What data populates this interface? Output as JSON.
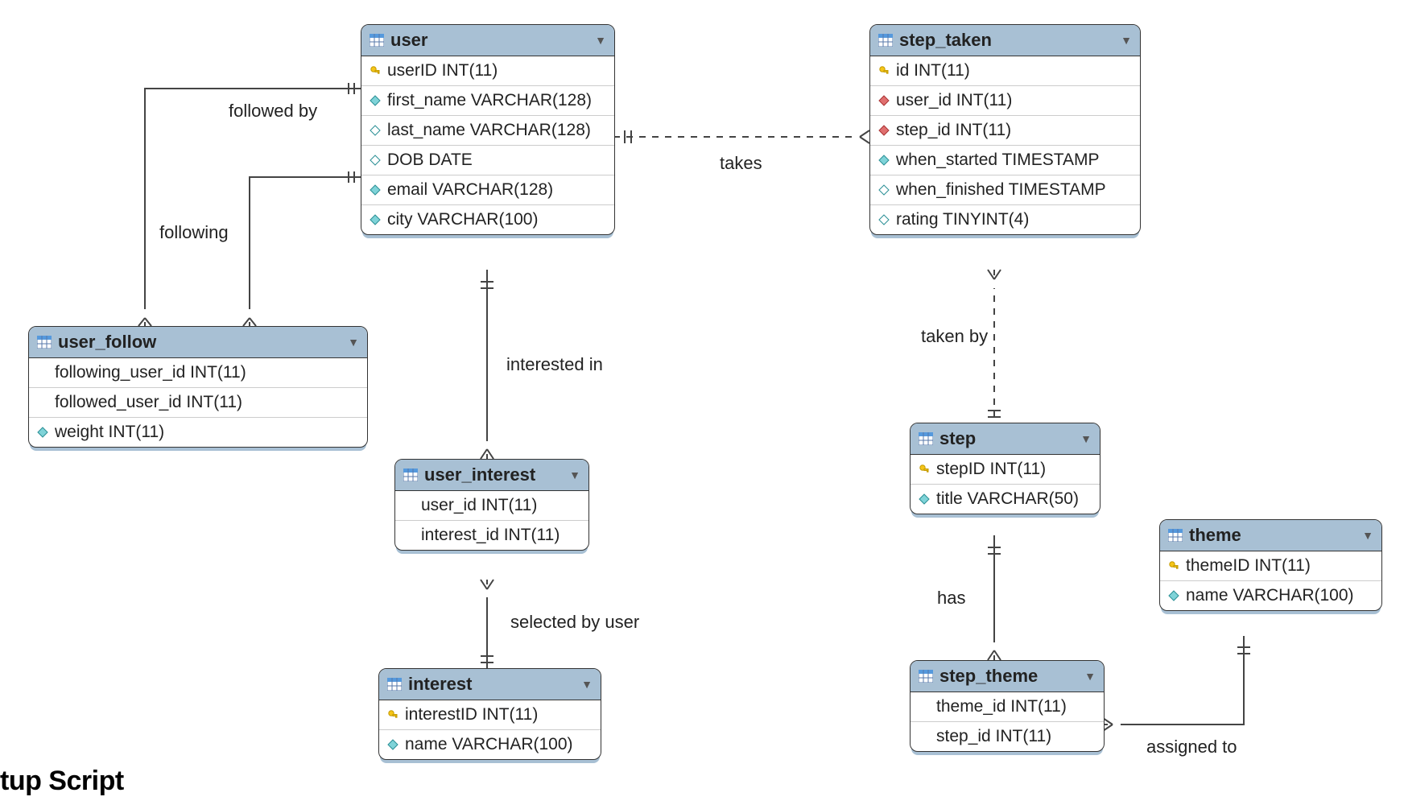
{
  "entities": {
    "user": {
      "title": "user",
      "cols": [
        {
          "icon": "key",
          "name": "userID INT(11)"
        },
        {
          "icon": "filled-diamond",
          "name": "first_name VARCHAR(128)"
        },
        {
          "icon": "open-diamond",
          "name": "last_name VARCHAR(128)"
        },
        {
          "icon": "open-diamond",
          "name": "DOB DATE"
        },
        {
          "icon": "filled-diamond",
          "name": "email VARCHAR(128)"
        },
        {
          "icon": "filled-diamond",
          "name": "city VARCHAR(100)"
        }
      ]
    },
    "step_taken": {
      "title": "step_taken",
      "cols": [
        {
          "icon": "key",
          "name": "id INT(11)"
        },
        {
          "icon": "red-diamond",
          "name": "user_id INT(11)"
        },
        {
          "icon": "red-diamond",
          "name": "step_id INT(11)"
        },
        {
          "icon": "filled-diamond",
          "name": "when_started TIMESTAMP"
        },
        {
          "icon": "open-diamond",
          "name": "when_finished TIMESTAMP"
        },
        {
          "icon": "open-diamond",
          "name": "rating TINYINT(4)"
        }
      ]
    },
    "user_follow": {
      "title": "user_follow",
      "cols": [
        {
          "icon": "none",
          "name": "following_user_id INT(11)"
        },
        {
          "icon": "none",
          "name": "followed_user_id INT(11)"
        },
        {
          "icon": "filled-diamond",
          "name": "weight INT(11)"
        }
      ]
    },
    "user_interest": {
      "title": "user_interest",
      "cols": [
        {
          "icon": "none",
          "name": "user_id INT(11)"
        },
        {
          "icon": "none",
          "name": "interest_id INT(11)"
        }
      ]
    },
    "interest": {
      "title": "interest",
      "cols": [
        {
          "icon": "key",
          "name": "interestID INT(11)"
        },
        {
          "icon": "filled-diamond",
          "name": "name VARCHAR(100)"
        }
      ]
    },
    "step": {
      "title": "step",
      "cols": [
        {
          "icon": "key",
          "name": "stepID INT(11)"
        },
        {
          "icon": "filled-diamond",
          "name": "title VARCHAR(50)"
        }
      ]
    },
    "theme": {
      "title": "theme",
      "cols": [
        {
          "icon": "key",
          "name": "themeID INT(11)"
        },
        {
          "icon": "filled-diamond",
          "name": "name VARCHAR(100)"
        }
      ]
    },
    "step_theme": {
      "title": "step_theme",
      "cols": [
        {
          "icon": "none",
          "name": "theme_id INT(11)"
        },
        {
          "icon": "none",
          "name": "step_id INT(11)"
        }
      ]
    }
  },
  "relationships": {
    "followed_by": "followed by",
    "following": "following",
    "interested_in": "interested in",
    "selected_by_user": "selected by user",
    "takes": "takes",
    "taken_by": "taken by",
    "has": "has",
    "assigned_to": "assigned to"
  },
  "bottom_text": "tup Script"
}
